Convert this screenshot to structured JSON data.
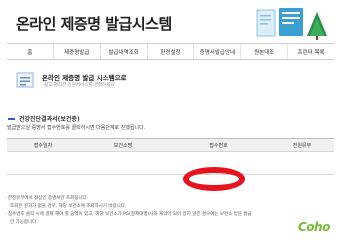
{
  "page": {
    "title": "온라인 제증명 발급시스템"
  },
  "nav": {
    "items": [
      {
        "label": "홈"
      },
      {
        "label": "제증명발급"
      },
      {
        "label": "발급내역조회"
      },
      {
        "label": "환경설정"
      },
      {
        "label": "증명서발급안내"
      },
      {
        "label": "원본대조"
      },
      {
        "label": "프린터 목록"
      }
    ]
  },
  "intro": {
    "title": "온라인 제증명 발급 시스템으로",
    "subtitle": "쉽고 편리한 민원서비스를 경험하세요."
  },
  "section": {
    "title": "건강진단결과서(보건증)",
    "instruction": "발급받으실 증명서 접수번호를 클릭하시면 다음단계로 진행됩니다."
  },
  "table": {
    "headers": [
      "접수일자",
      "보건소명",
      "접수번호",
      "전원유무"
    ]
  },
  "notes": [
    "· 한정유무에서 정상인 증명서만 조회됩니다.",
    "조회된 결과가 없을 경우, 해당 보건소에 조회하시기 바랍니다.",
    "· 접수번호 클릭 시에 결제 해야 할 금액이 있고, 해당 보건소가 PG(결제대행)사와 계약이 되어 있지 않은 경우에는 보건소 방문 발급",
    "만 가능합니다."
  ],
  "logo": {
    "text": "Coho"
  },
  "colors": {
    "accent": "#2a5bb8",
    "highlight_oval": "#e5141e",
    "logo": "#79b83a"
  }
}
